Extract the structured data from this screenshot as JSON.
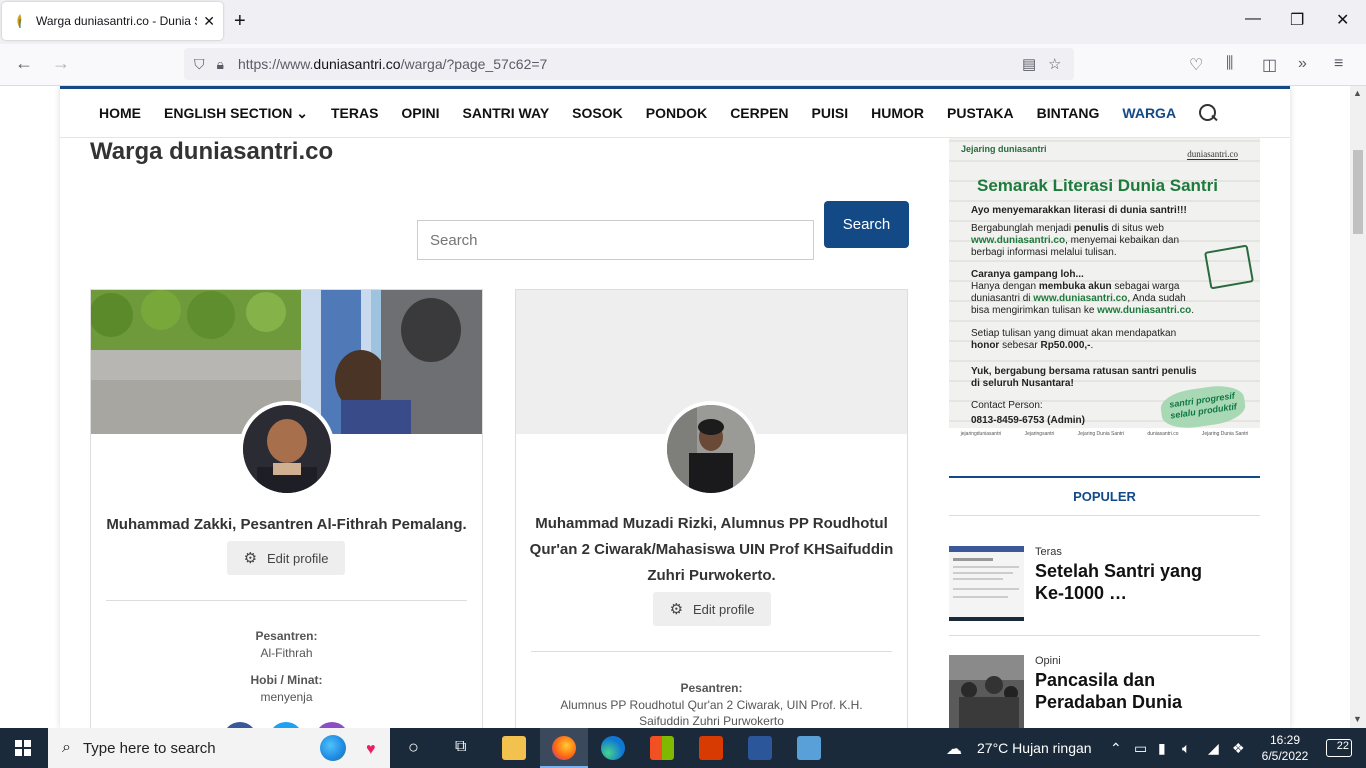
{
  "browser": {
    "tab_title": "Warga duniasantri.co - Dunia Sa",
    "url_prefix": "https://www.",
    "url_domain": "duniasantri.co",
    "url_path": "/warga/?page_57c62=7"
  },
  "nav": {
    "items": [
      "HOME",
      "ENGLISH SECTION ⌄",
      "TERAS",
      "OPINI",
      "SANTRI WAY",
      "SOSOK",
      "PONDOK",
      "CERPEN",
      "PUISI",
      "HUMOR",
      "PUSTAKA",
      "BINTANG",
      "WARGA"
    ],
    "active": "WARGA"
  },
  "page": {
    "title": "Warga duniasantri.co",
    "search_placeholder": "Search",
    "search_button": "Search"
  },
  "members": [
    {
      "name": "Muhammad Zakki, Pesantren Al-Fithrah Pemalang.",
      "edit_label": "Edit profile",
      "pesantren_label": "Pesantren:",
      "pesantren": "Al-Fithrah",
      "hobi_label": "Hobi / Minat:",
      "hobi": "menyenja"
    },
    {
      "name": "Muhammad Muzadi Rizki, Alumnus PP Roudhotul Qur'an 2 Ciwarak/Mahasiswa UIN Prof KHSaifuddin Zuhri Purwokerto.",
      "edit_label": "Edit profile",
      "pesantren_label": "Pesantren:",
      "pesantren": "Alumnus PP Roudhotul Qur'an 2 Ciwarak, UIN Prof. K.H. Saifuddin Zuhri Purwokerto"
    }
  ],
  "banner": {
    "logo_small": "Jejaring duniasantri",
    "logo_right": "duniasantri.co",
    "heading": "Semarak Literasi Dunia Santri",
    "line1": "Ayo menyemarakkan literasi di dunia santri!!!",
    "line2a": "Bergabunglah menjadi ",
    "line2b": "penulis",
    "line2c": " di situs web",
    "line3a": "www.duniasantri.co",
    "line3b": ", menyemai kebaikan dan",
    "line4": "berbagi informasi melalui tulisan.",
    "line5": "Caranya gampang loh...",
    "line6a": "Hanya dengan ",
    "line6b": "membuka akun",
    "line6c": " sebagai warga",
    "line7a": "duniasantri di ",
    "line7b": "www.duniasantri.co",
    "line7c": ", Anda sudah",
    "line8a": "bisa mengirimkan tulisan ke ",
    "line8b": "www.duniasantri.co",
    "line8c": ".",
    "line9": "Setiap tulisan yang dimuat akan mendapatkan",
    "line10a": "honor",
    "line10b": " sebesar ",
    "line10c": "Rp50.000,-",
    "line10d": ".",
    "line11": "Yuk, bergabung bersama ratusan santri penulis",
    "line12": "di seluruh Nusantara!",
    "contact_label": "Contact Person:",
    "contact": "0813-8459-6753 (Admin)",
    "stamp": "santri progresif selalu produktif",
    "footer": [
      "jejaringduniasantri",
      "Jejaringsantri",
      "Jejaring Dunia Santri",
      "duniasantri.co",
      "Jejaring Dunia Santri"
    ]
  },
  "popular": {
    "heading": "POPULER",
    "items": [
      {
        "category": "Teras",
        "title": "Setelah Santri yang Ke-1000 …"
      },
      {
        "category": "Opini",
        "title": "Pancasila dan Peradaban Dunia"
      }
    ]
  },
  "taskbar": {
    "search_placeholder": "Type here to search",
    "weather": "27°C  Hujan ringan",
    "time": "16:29",
    "date": "6/5/2022",
    "notifications": "22"
  },
  "colors": {
    "brand": "#134a86",
    "banner_green": "#1e7a3c"
  }
}
